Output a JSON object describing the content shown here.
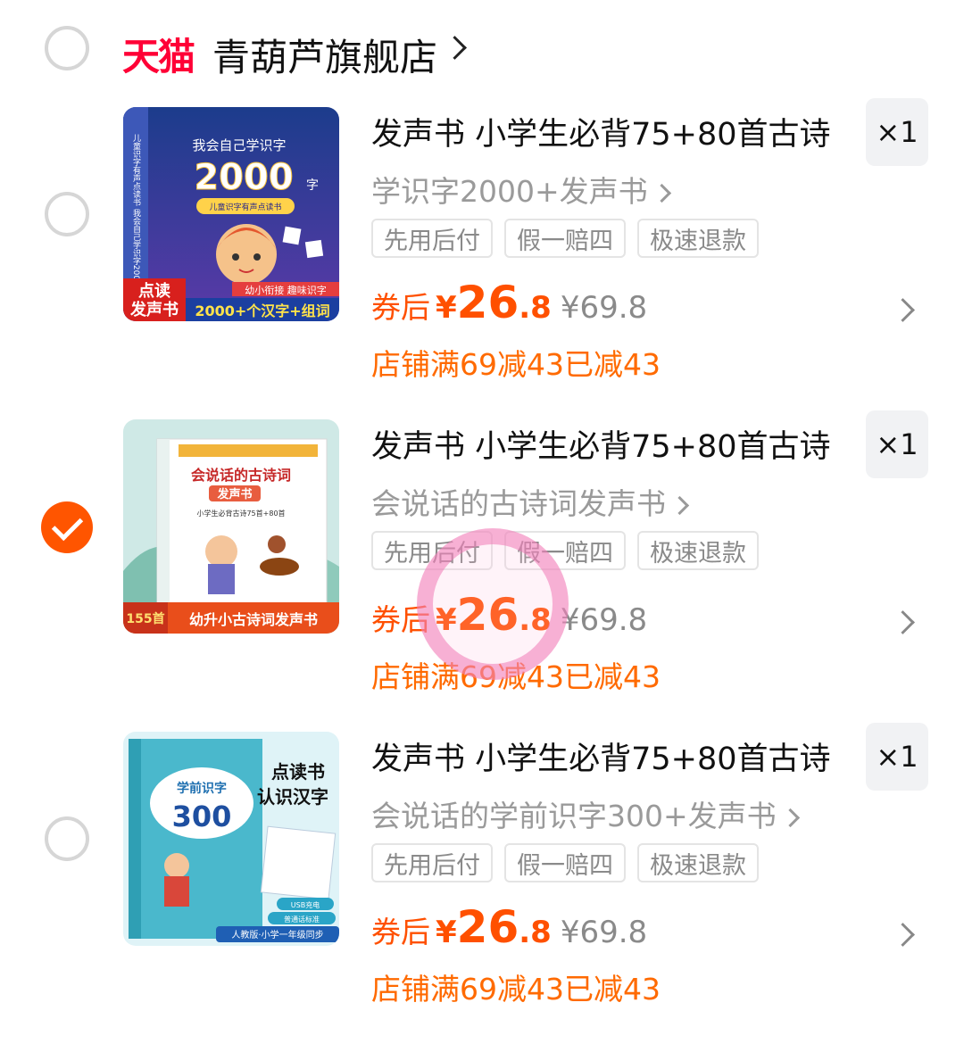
{
  "shop": {
    "logo": "天猫",
    "name": "青葫芦旗舰店"
  },
  "colors": {
    "accent": "#ff5500",
    "price": "#ff5000",
    "tmall": "#ff0036",
    "touch_marker": "#f078b4"
  },
  "items": [
    {
      "title": "发声书 小学生必背75+80首古诗",
      "sku": "学识字2000+发声书",
      "qty": "×1",
      "tags": [
        "先用后付",
        "假一赔四",
        "极速退款"
      ],
      "price_label": "券后",
      "price_yen": "¥",
      "price_int": "26",
      "price_dec": ".8",
      "original_price": "¥69.8",
      "promo": "店铺满69减43已减43",
      "selected": false,
      "cover": {
        "top_text": "我会自己学识字",
        "big_number": "2000",
        "unit": "字",
        "ribbon": "儿童识字有声点读书",
        "side": "儿童识字有声点读书 我会自己学识字2000",
        "badge_left_1": "点读",
        "badge_left_2": "发声书",
        "badge_right_1": "幼小衔接 趣味识字",
        "badge_right_2": "2000+个汉字+组词"
      }
    },
    {
      "title": "发声书 小学生必背75+80首古诗",
      "sku": "会说话的古诗词发声书",
      "qty": "×1",
      "tags": [
        "先用后付",
        "假一赔四",
        "极速退款"
      ],
      "price_label": "券后",
      "price_yen": "¥",
      "price_int": "26",
      "price_dec": ".8",
      "original_price": "¥69.8",
      "promo": "店铺满69减43已减43",
      "selected": true,
      "cover": {
        "title_1": "会说话的古诗词",
        "title_2": "发声书",
        "subtitle": "小学生必背古诗75首+80首",
        "badge_left": "155首",
        "badge_right": "幼升小古诗词发声书"
      }
    },
    {
      "title": "发声书 小学生必背75+80首古诗",
      "sku": "会说话的学前识字300+发声书",
      "qty": "×1",
      "tags": [
        "先用后付",
        "假一赔四",
        "极速退款"
      ],
      "price_label": "券后",
      "price_yen": "¥",
      "price_int": "26",
      "price_dec": ".8",
      "original_price": "¥69.8",
      "promo": "店铺满69减43已减43",
      "selected": false,
      "cover": {
        "headline_1": "点读书",
        "headline_2": "认识汉字",
        "book_title": "学前识字",
        "big_number": "300",
        "feature_1": "USB充电",
        "feature_2": "普通话标准",
        "footer": "人教版·小学一年级同步"
      }
    }
  ]
}
